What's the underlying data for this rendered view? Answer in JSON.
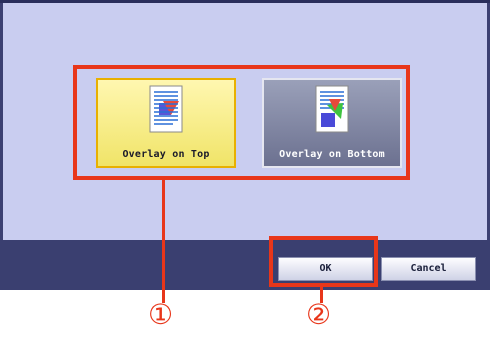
{
  "options": {
    "overlay_top": {
      "label": "Overlay on Top",
      "icon": "overlay-top-document-icon"
    },
    "overlay_bottom": {
      "label": "Overlay on Bottom",
      "icon": "overlay-bottom-document-icon"
    }
  },
  "buttons": {
    "ok": "OK",
    "cancel": "Cancel"
  },
  "callouts": {
    "one": "①",
    "two": "②"
  },
  "colors": {
    "highlight": "#e8361a",
    "selected_option": "#f7ee92",
    "panel": "#c9cdf0"
  }
}
